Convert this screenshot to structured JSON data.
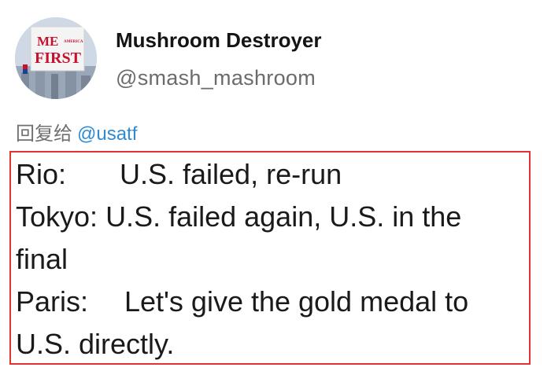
{
  "user": {
    "display_name": "Mushroom Destroyer",
    "handle": "@smash_mashroom",
    "avatar": {
      "icon": "me-first-billboard-avatar",
      "line1": "ME",
      "line2": "FIRST",
      "small_text": "AMERICA"
    }
  },
  "reply": {
    "label": "回复给",
    "mention": "@usatf"
  },
  "tweet": {
    "rio_label": "Rio:",
    "rio_text": "U.S. failed, re-run",
    "tokyo_label": "Tokyo:",
    "tokyo_text": "U.S. failed again, U.S. in the",
    "tokyo_text_cont": "final",
    "paris_label": "Paris:",
    "paris_text": "Let's give the gold medal to",
    "paris_text_cont": "U.S. directly."
  },
  "colors": {
    "mention": "#2d8ad4",
    "highlight_border": "#e53232",
    "handle": "#6b6b6b"
  }
}
